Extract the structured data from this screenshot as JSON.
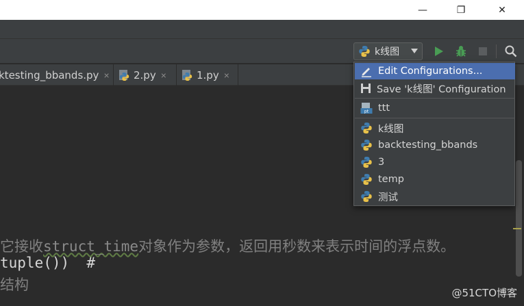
{
  "window": {
    "minimize_glyph": "—",
    "maximize_glyph": "❐",
    "close_glyph": "✕"
  },
  "toolbar": {
    "run_config_label": "k线图",
    "icons": [
      "python-icon",
      "run-icon",
      "debug-icon",
      "stop-icon",
      "search-icon"
    ],
    "colors": {
      "run": "#499c54",
      "debug": "#499c54",
      "stop": "#5a5d5f"
    }
  },
  "tabs": [
    {
      "label": "ktesting_bbands.py",
      "close": "×"
    },
    {
      "label": "2.py",
      "close": "×"
    },
    {
      "label": "1.py",
      "close": "×"
    }
  ],
  "dropdown": {
    "edit_label": "Edit Configurations...",
    "save_label": "Save 'k线图' Configuration",
    "special_items": [
      "ttt"
    ],
    "configs": [
      "k线图",
      "backtesting_bbands",
      "3",
      "temp",
      "测试"
    ],
    "selected_color": "#4b6eaf"
  },
  "editor": {
    "line1_a": "它接收",
    "line1_kw": "struct_time",
    "line1_b": "对象作为参数，返回用秒数来表示时间的浮点数。",
    "line2": "tuple())  #",
    "line3": "结构"
  },
  "watermark": "@51CTO博客"
}
